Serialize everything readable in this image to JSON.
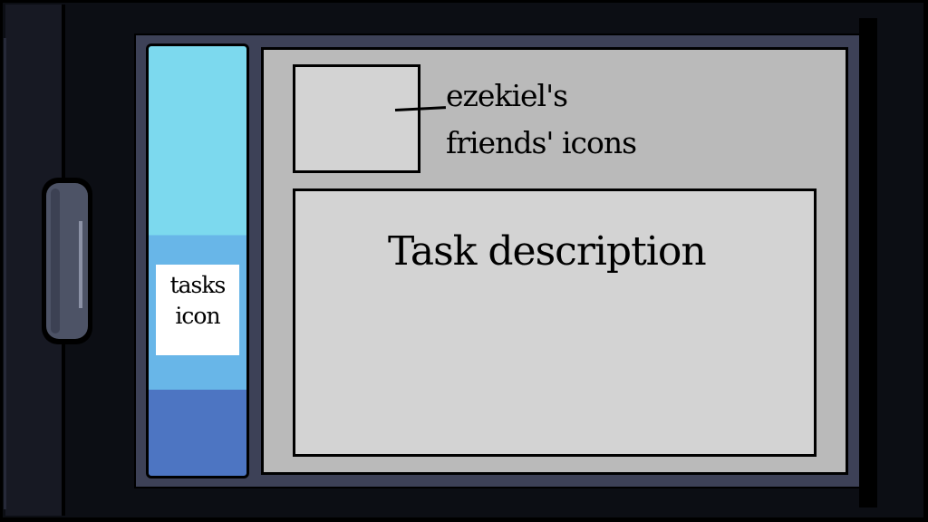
{
  "tasks_panel": {
    "icon_label": "tasks\nicon",
    "colors": {
      "top": "#7cd9ee",
      "middle": "#68b6e8",
      "bottom": "#4d75c2"
    }
  },
  "friends": {
    "label": "ezekiel's\nfriends' icons"
  },
  "task": {
    "label": "Task description"
  },
  "colors": {
    "frame": "#0c0e14",
    "bezel": "#3d4157",
    "panel": "#bababa",
    "box": "#d3d3d3",
    "handle": "#4d5366"
  }
}
